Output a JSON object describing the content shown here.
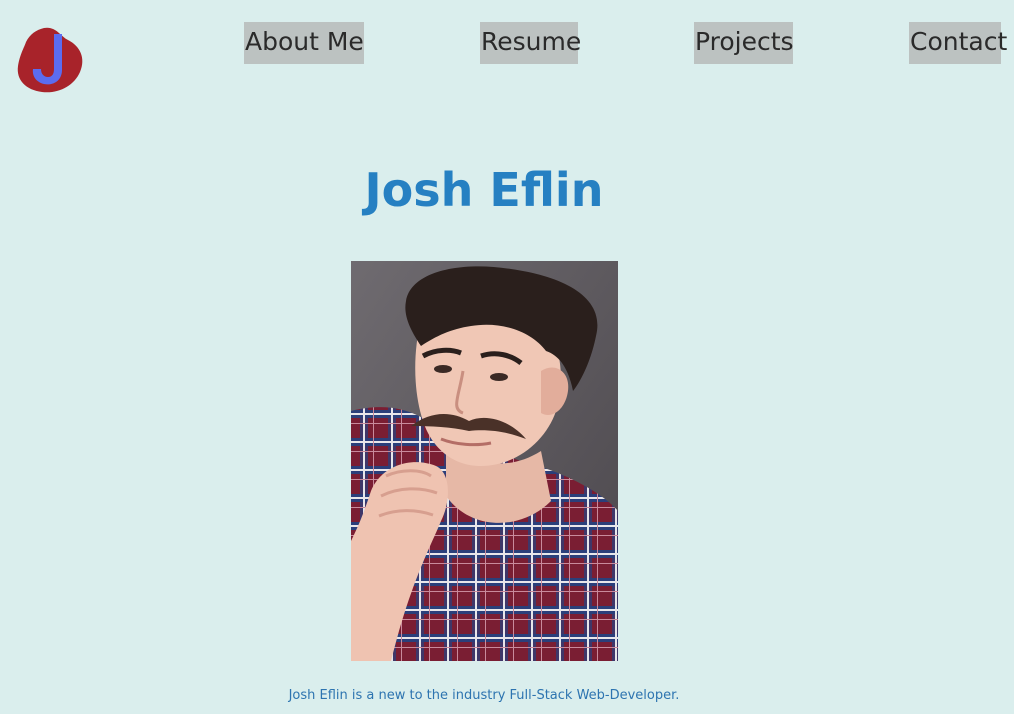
{
  "nav": {
    "about_label": "About Me",
    "resume_label": "Resume",
    "projects_label": "Projects",
    "contact_label": "Contact"
  },
  "logo": {
    "letter": "J"
  },
  "hero": {
    "title": "Josh Eflin",
    "photo_alt": "Portrait of Josh Eflin",
    "bio": "Josh Eflin is a new to the industry Full-Stack Web-Developer."
  },
  "colors": {
    "background": "#daeeed",
    "nav_button_bg": "#bcc2c1",
    "title_blue": "#2680c2",
    "logo_red": "#a8232a",
    "logo_blue": "#5b6cf0"
  }
}
